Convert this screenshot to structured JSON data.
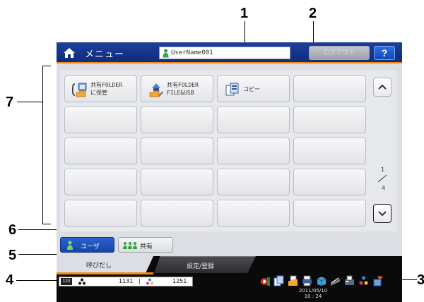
{
  "callouts": [
    "1",
    "2",
    "3",
    "4",
    "5",
    "6",
    "7"
  ],
  "header": {
    "menu_title": "メニュー",
    "user_name": "UserName001",
    "logout_label": "ログアウト",
    "help_label": "?"
  },
  "templates": [
    {
      "line1": "共有FOLDER",
      "line2": "に保管",
      "icon": "folder-save-icon"
    },
    {
      "line1": "共有FOLDER",
      "line2": "FILE&USB",
      "icon": "folder-usb-icon"
    },
    {
      "line1": "コピー",
      "line2": "",
      "icon": "copy-icon"
    }
  ],
  "pagination": {
    "current": "1",
    "total": "4"
  },
  "groups": {
    "user_label": "ユーザ",
    "shared_label": "共有"
  },
  "tabs": {
    "call_label": "呼びだし",
    "setting_label": "設定/登録"
  },
  "counter": {
    "icon_text": "123",
    "mono_count": "1131",
    "separator": "|",
    "color_count": "1251"
  },
  "clock": {
    "date": "2011/05/10",
    "time": "10 : 24"
  },
  "colors": {
    "header_blue": "#1e3f9a",
    "accent_orange": "#f08a12",
    "user_button_blue": "#2a63d0"
  }
}
